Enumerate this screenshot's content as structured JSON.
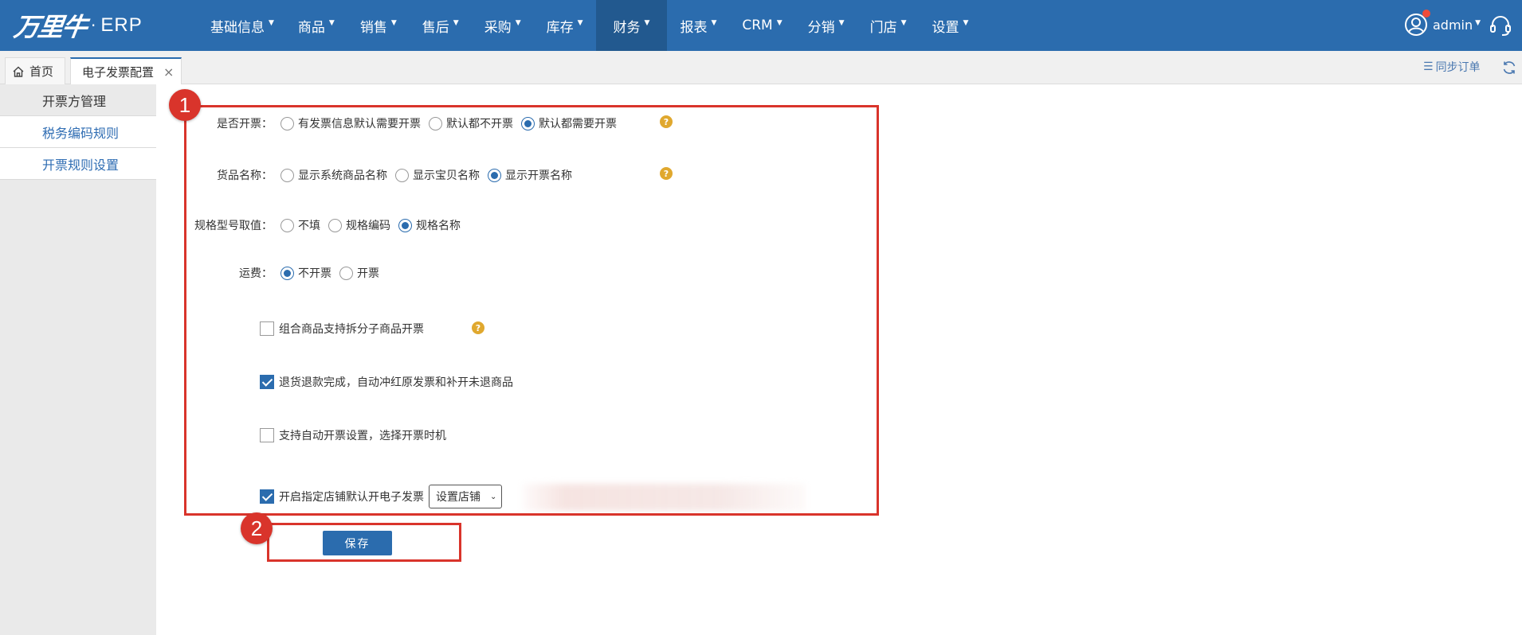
{
  "app": {
    "logo_text": "万里牛",
    "logo_sep": "·",
    "logo_erp": "ERP"
  },
  "nav": {
    "items": [
      {
        "label": "基础信息"
      },
      {
        "label": "商品"
      },
      {
        "label": "销售"
      },
      {
        "label": "售后"
      },
      {
        "label": "采购"
      },
      {
        "label": "库存"
      },
      {
        "label": "财务"
      },
      {
        "label": "报表"
      },
      {
        "label": "CRM"
      },
      {
        "label": "分销"
      },
      {
        "label": "门店"
      },
      {
        "label": "设置"
      }
    ],
    "active_index": 6
  },
  "user": {
    "name": "admin"
  },
  "tabs": {
    "home": "首页",
    "active": "电子发票配置",
    "close": "×"
  },
  "toolbar": {
    "sync_label": "同步订单"
  },
  "sidebar": {
    "items": [
      {
        "label": "开票方管理"
      },
      {
        "label": "税务编码规则"
      },
      {
        "label": "开票规则设置"
      }
    ]
  },
  "form": {
    "invoice": {
      "label": "是否开票：",
      "options": [
        "有发票信息默认需要开票",
        "默认都不开票",
        "默认都需要开票"
      ],
      "selected": 2
    },
    "goods_name": {
      "label": "货品名称：",
      "options": [
        "显示系统商品名称",
        "显示宝贝名称",
        "显示开票名称"
      ],
      "selected": 2
    },
    "spec": {
      "label": "规格型号取值：",
      "options": [
        "不填",
        "规格编码",
        "规格名称"
      ],
      "selected": 2
    },
    "freight": {
      "label": "运费：",
      "options": [
        "不开票",
        "开票"
      ],
      "selected": 0
    },
    "checkboxes": [
      {
        "label": "组合商品支持拆分子商品开票",
        "checked": false
      },
      {
        "label": "退货退款完成，自动冲红原发票和补开未退商品",
        "checked": true
      },
      {
        "label": "支持自动开票设置，选择开票时机",
        "checked": false
      },
      {
        "label": "开启指定店铺默认开电子发票",
        "checked": true
      }
    ],
    "shop_select": "设置店铺",
    "help_glyph": "?"
  },
  "save_label": "保存",
  "annotations": [
    "1",
    "2"
  ],
  "colors": {
    "brand": "#2b6cae",
    "brand_dark": "#22598f",
    "annotation": "#d9342b",
    "help": "#e0a82e",
    "link": "#2f6db3"
  }
}
